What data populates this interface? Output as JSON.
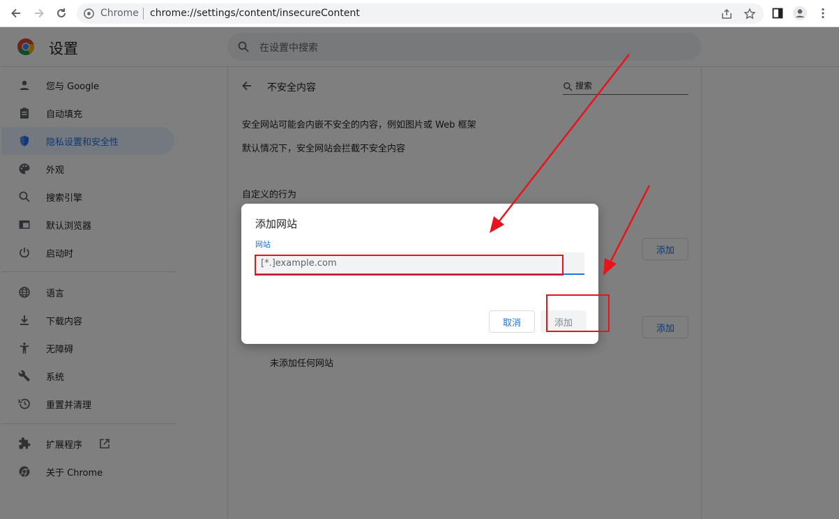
{
  "browser": {
    "site_label": "Chrome",
    "url": "chrome://settings/content/insecureContent"
  },
  "header": {
    "title": "设置",
    "search_placeholder": "在设置中搜索"
  },
  "sidebar": {
    "items": [
      {
        "label": "您与 Google",
        "icon": "person-icon"
      },
      {
        "label": "自动填充",
        "icon": "clipboard-icon"
      },
      {
        "label": "隐私设置和安全性",
        "icon": "shield-icon",
        "active": true
      },
      {
        "label": "外观",
        "icon": "palette-icon"
      },
      {
        "label": "搜索引擎",
        "icon": "search-icon"
      },
      {
        "label": "默认浏览器",
        "icon": "browser-icon"
      },
      {
        "label": "启动时",
        "icon": "power-icon"
      },
      {
        "label": "语言",
        "icon": "globe-icon"
      },
      {
        "label": "下载内容",
        "icon": "download-icon"
      },
      {
        "label": "无障碍",
        "icon": "accessibility-icon"
      },
      {
        "label": "系统",
        "icon": "wrench-icon"
      },
      {
        "label": "重置并清理",
        "icon": "restore-icon"
      },
      {
        "label": "扩展程序",
        "icon": "puzzle-icon"
      },
      {
        "label": "关于 Chrome",
        "icon": "chrome-icon"
      }
    ]
  },
  "main": {
    "section_title": "不安全内容",
    "search_placeholder": "搜索",
    "description_1": "安全网站可能会内嵌不安全的内容，例如图片或 Web 框架",
    "description_2": "默认情况下，安全网站会拦截不安全内容",
    "custom_title": "自定义的行为",
    "add_label": "添加",
    "empty_text": "未添加任何网站"
  },
  "dialog": {
    "title": "添加网站",
    "field_label": "网站",
    "placeholder": "[*.]example.com",
    "cancel_label": "取消",
    "add_label": "添加"
  },
  "colors": {
    "accent": "#1a73e8",
    "annotation": "#e8141b"
  }
}
